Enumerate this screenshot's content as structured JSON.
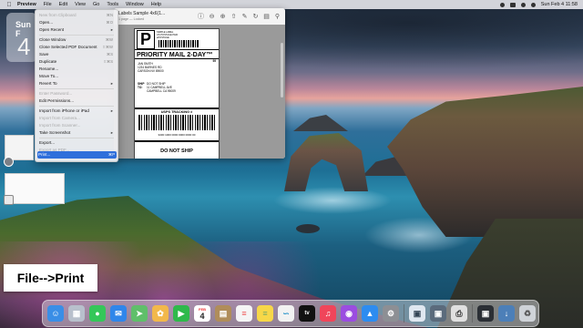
{
  "menubar": {
    "app_name": "Preview",
    "menus": [
      "File",
      "Edit",
      "View",
      "Go",
      "Tools",
      "Window",
      "Help"
    ],
    "clock": "Sun Feb 4 11:58"
  },
  "calendar_widget": {
    "day": "Sun F",
    "date": "4"
  },
  "preview_window": {
    "title": "Labels Sample 4x6(1...",
    "subtitle": "1 page — Locked"
  },
  "label": {
    "service_letter": "P",
    "header_lines": [
      "SIMPLE LABEL",
      "US POSTAGE PAID",
      "ePOSTAGE"
    ],
    "service": "PRIORITY MAIL 2-DAY™",
    "date_code": "99",
    "from_address": "JAN SMITH\n1234 BARNES RD\nCARSON NV 89000",
    "ship_to_label": "SHIP\nTO:",
    "to_address": "DO NOT SHIP\n11 CAMPBELL AVE\nCAMPBELL CA 95009",
    "tracking_header": "USPS TRACKING #",
    "tracking_number": "9400 1000 0000 0000 0000 00",
    "footer": "DO NOT SHIP"
  },
  "file_menu": {
    "items": [
      {
        "label": "New from Clipboard",
        "shortcut": "⌘N",
        "disabled": true
      },
      {
        "label": "Open...",
        "shortcut": "⌘O"
      },
      {
        "label": "Open Recent",
        "submenu": true
      },
      {
        "label": "Close Window",
        "shortcut": "⌘W"
      },
      {
        "label": "Close Selected PDF Document",
        "shortcut": "⇧⌘W"
      },
      {
        "label": "Save",
        "shortcut": "⌘S"
      },
      {
        "label": "Duplicate",
        "shortcut": "⇧⌘S"
      },
      {
        "label": "Rename..."
      },
      {
        "label": "Move To..."
      },
      {
        "label": "Revert To",
        "submenu": true
      },
      {
        "label": "Enter Password...",
        "disabled": true
      },
      {
        "label": "Edit Permissions..."
      },
      {
        "label": "Import from iPhone or iPad",
        "submenu": true
      },
      {
        "label": "Import from Camera...",
        "disabled": true
      },
      {
        "label": "Import from Scanner...",
        "disabled": true
      },
      {
        "label": "Take Screenshot",
        "submenu": true
      },
      {
        "label": "Export..."
      },
      {
        "label": "Export as PDF...",
        "disabled": true
      },
      {
        "label": "Share",
        "submenu": true
      },
      {
        "label": "Print...",
        "shortcut": "⌘P",
        "highlighted": true
      }
    ]
  },
  "caption": "File-->Print",
  "dock": {
    "apps": [
      {
        "icon": "finder-icon",
        "color": "#3a8ee6"
      },
      {
        "icon": "launchpad-icon",
        "color": "#b8c0cc"
      },
      {
        "icon": "messages-icon",
        "color": "#34c759"
      },
      {
        "icon": "mail-icon",
        "color": "#2f86ea"
      },
      {
        "icon": "maps-icon",
        "color": "#5fbf6a"
      },
      {
        "icon": "photos-icon",
        "color": "#f2b84b"
      },
      {
        "icon": "facetime-icon",
        "color": "#2fb94b"
      },
      {
        "icon": "calendar-icon",
        "color": "#ffffff"
      },
      {
        "icon": "notes-icon",
        "color": "#b08d5a"
      },
      {
        "icon": "reminders-icon",
        "color": "#f5f5f5"
      },
      {
        "icon": "notes2-icon",
        "color": "#f7d748"
      },
      {
        "icon": "freeform-icon",
        "color": "#f2f2f2"
      },
      {
        "icon": "tv-icon",
        "color": "#111111"
      },
      {
        "icon": "music-icon",
        "color": "#f0455a"
      },
      {
        "icon": "podcasts-icon",
        "color": "#9b4de0"
      },
      {
        "icon": "app-store-icon",
        "color": "#2d8cf0"
      },
      {
        "icon": "system-settings-icon",
        "color": "#8d8f94"
      },
      {
        "icon": "preview-icon",
        "color": "#dfe7f0"
      },
      {
        "icon": "screenshot-icon",
        "color": "#5b6b7c"
      },
      {
        "icon": "printer-icon",
        "color": "#e0e0e0"
      },
      {
        "icon": "screen-mirror-icon",
        "color": "#2b2f35"
      },
      {
        "icon": "downloads-icon",
        "color": "#4c7fb8"
      },
      {
        "icon": "trash-icon",
        "color": "#cfd3d8"
      }
    ],
    "calendar_month": "FEB",
    "calendar_day": "4",
    "tv_label": "tv"
  }
}
